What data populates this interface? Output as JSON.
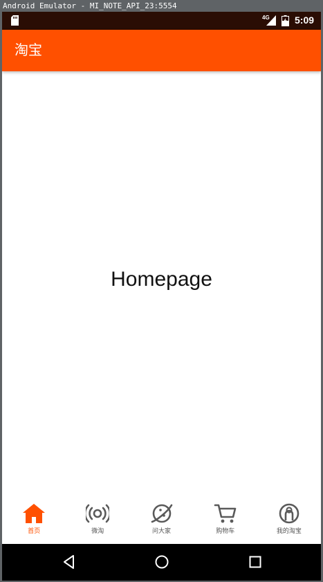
{
  "window": {
    "title": "Android Emulator - MI_NOTE_API_23:5554"
  },
  "status_bar": {
    "network": "4G",
    "time": "5:09"
  },
  "app_bar": {
    "title": "淘宝"
  },
  "content": {
    "label": "Homepage"
  },
  "bottom_nav": {
    "active_color": "#ff5000",
    "items": [
      {
        "label": "首页",
        "icon": "home-icon",
        "active": true
      },
      {
        "label": "微淘",
        "icon": "broadcast-icon",
        "active": false
      },
      {
        "label": "问大家",
        "icon": "planet-icon",
        "active": false
      },
      {
        "label": "购物车",
        "icon": "cart-icon",
        "active": false
      },
      {
        "label": "我的淘宝",
        "icon": "profile-icon",
        "active": false
      }
    ]
  },
  "system_nav": {
    "buttons": [
      "back-icon",
      "home-circle-icon",
      "recents-icon"
    ]
  }
}
